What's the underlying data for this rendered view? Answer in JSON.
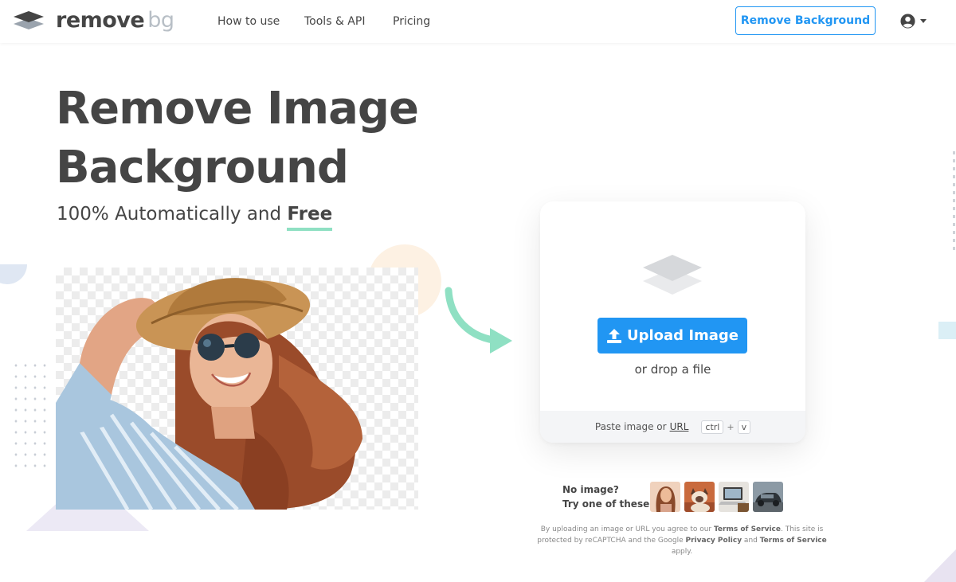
{
  "header": {
    "logo": {
      "part1": "remove",
      "part2": "bg"
    },
    "nav": [
      "How to use",
      "Tools & API",
      "Pricing"
    ],
    "cta_label": "Remove Background",
    "icons": {
      "user": "user-circle-icon",
      "caret": "caret-down-icon"
    }
  },
  "hero": {
    "title_line1": "Remove Image",
    "title_line2": "Background",
    "subtitle_prefix": "100% Automatically and ",
    "subtitle_highlight": "Free"
  },
  "upload": {
    "button_label": "Upload Image",
    "drop_text": "or drop a file",
    "paste_prefix": "Paste image or ",
    "paste_url": "URL",
    "key_ctrl": "ctrl",
    "key_plus": "+",
    "key_v": "v",
    "icons": {
      "layers": "layers-icon",
      "upload": "upload-icon"
    }
  },
  "samples": {
    "label_line1": "No image?",
    "label_line2": "Try one of these:",
    "thumbnails": [
      "woman-sample",
      "cat-sample",
      "laptop-sample",
      "car-sample"
    ]
  },
  "legal": {
    "t1": "By uploading an image or URL you agree to our ",
    "terms1": "Terms of Service",
    "t2": ". This site is protected by reCAPTCHA and the Google ",
    "privacy": "Privacy Policy",
    "t3": " and ",
    "terms2": "Terms of Service",
    "t4": " apply."
  },
  "colors": {
    "accent": "#2196f3",
    "text": "#454545",
    "highlight_underline": "#8fe0c3",
    "arrow": "#8fe0c3"
  }
}
